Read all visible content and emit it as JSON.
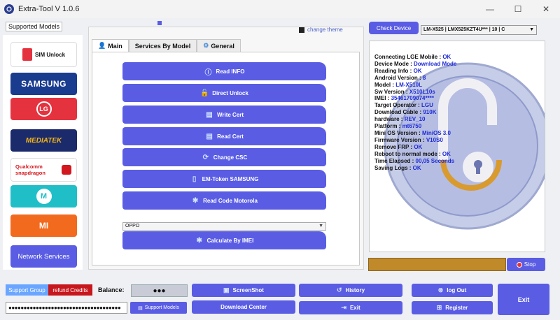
{
  "window": {
    "title": "Extra-Tool V 1.0.6",
    "controls": [
      "—",
      "☐",
      "✕"
    ]
  },
  "sidebar": {
    "label": "Supported Models",
    "brands": [
      {
        "name": "sim-unlock",
        "label": "SIM Unlock",
        "bg": "#ffffff",
        "fg": "#111111"
      },
      {
        "name": "samsung",
        "label": "SAMSUNG",
        "bg": "#1a3c8f",
        "fg": "#ffffff"
      },
      {
        "name": "lg",
        "label": "LG",
        "bg": "#e5323f",
        "fg": "#ffffff"
      },
      {
        "name": "mediatek",
        "label": "MEDIATEK",
        "bg": "#1b2a6b",
        "fg": "#f5b617"
      },
      {
        "name": "snapdragon",
        "label": "Qualcomm snapdragon",
        "bg": "#ffffff",
        "fg": "#d3171e"
      },
      {
        "name": "motorola",
        "label": "M",
        "bg": "#20bfc8",
        "fg": "#ffffff"
      },
      {
        "name": "mi",
        "label": "MI",
        "bg": "#f26a1e",
        "fg": "#ffffff"
      },
      {
        "name": "network",
        "label": "Network Services",
        "bg": "#5a5de3",
        "fg": "#ffffff"
      }
    ]
  },
  "center": {
    "change_theme": "change theme",
    "tabs": [
      {
        "label": "Main",
        "icon": "user-icon",
        "active": true
      },
      {
        "label": "Services By Model",
        "icon": "",
        "active": false
      },
      {
        "label": "General",
        "icon": "gear-icon",
        "active": false
      }
    ],
    "buttons": [
      {
        "label": "Read INFO",
        "icon": "info-icon"
      },
      {
        "label": "Direct Unlock",
        "icon": "lock-icon"
      },
      {
        "label": "Write Cert",
        "icon": "document-icon"
      },
      {
        "label": "Read Cert",
        "icon": "document-icon"
      },
      {
        "label": "Change CSC",
        "icon": "refresh-icon"
      },
      {
        "label": "EM-Token SAMSUNG",
        "icon": "phone-icon"
      },
      {
        "label": "Read Code Motorola",
        "icon": "wrench-icon"
      }
    ],
    "model_select": "OPPO",
    "calc_button": "Calculate By IMEI"
  },
  "right": {
    "check_device": "Check Device",
    "device_select": "LM-X525 | LMX525KZT4U*** | 10 | C",
    "log": [
      {
        "k": "Connecting LGE Mobile : ",
        "v": "OK"
      },
      {
        "k": "Device Mode : ",
        "v": "Download Mode"
      },
      {
        "k": "Reading Info : ",
        "v": "OK"
      },
      {
        "k": "Android Version : ",
        "v": "8"
      },
      {
        "k": "Model : ",
        "v": "LM-X510L"
      },
      {
        "k": "Sw Version : ",
        "v": "X510L10s"
      },
      {
        "k": "IMEI : ",
        "v": "35461709074****"
      },
      {
        "k": "Target Operator : ",
        "v": "LGU"
      },
      {
        "k": "Download Cable : ",
        "v": "910K"
      },
      {
        "k": "hardware : ",
        "v": "REV_10"
      },
      {
        "k": "Platform : ",
        "v": "mt6750"
      },
      {
        "k": "Mini OS Version : ",
        "v": "MiniOS 3.0"
      },
      {
        "k": "Firmware Version : ",
        "v": "V10S0"
      },
      {
        "k": "Remove FRP : ",
        "v": "OK"
      },
      {
        "k": "Reboot to normal mode : ",
        "v": "OK"
      },
      {
        "k": "Time Elapsed : ",
        "v": "00,05 Seconds"
      },
      {
        "k": "Saving Logs : ",
        "v": "OK"
      }
    ],
    "progress_fraction": 1.0,
    "stop": "Stop"
  },
  "bottom": {
    "support_group": "Support Group",
    "refund": "refund Credits",
    "balance_label": "Balance:",
    "balance_value": "●●●",
    "password": "●●●●●●●●●●●●●●●●●●●●●●●●●●●●●●●●●●●●●",
    "support_models": "Support Models",
    "screenshot": "ScreenShot",
    "download_center": "Download  Center",
    "history": "History",
    "exit_small": "Exit",
    "logout": "log Out",
    "register": "Register",
    "exit": "Exit"
  },
  "colors": {
    "accent": "#5a5de3",
    "progress": "#c08a2a",
    "refund": "#c8161d",
    "support": "#6aa6ff"
  }
}
